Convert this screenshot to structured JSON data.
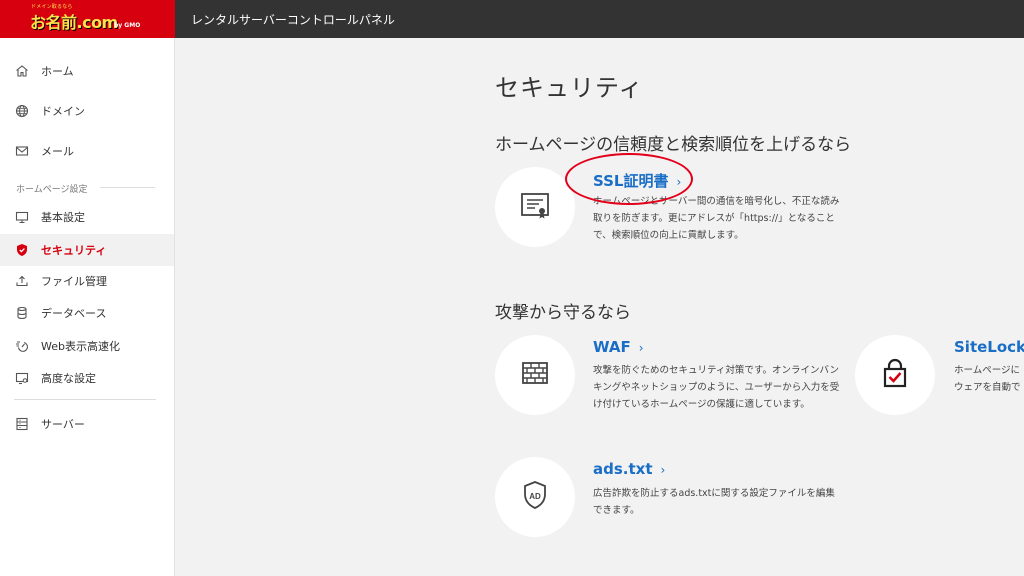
{
  "logo": {
    "tagline": "ドメイン取るなら",
    "brand": "お名前.com",
    "sub": "by GMO"
  },
  "header": {
    "title": "レンタルサーバーコントロールパネル"
  },
  "sidebar": {
    "items": [
      {
        "label": "ホーム",
        "icon": "home-icon"
      },
      {
        "label": "ドメイン",
        "icon": "globe-icon"
      },
      {
        "label": "メール",
        "icon": "mail-icon"
      }
    ],
    "section_label": "ホームページ設定",
    "settings_items": [
      {
        "label": "基本設定",
        "icon": "monitor-icon"
      },
      {
        "label": "セキュリティ",
        "icon": "shield-icon",
        "active": true
      },
      {
        "label": "ファイル管理",
        "icon": "upload-icon"
      },
      {
        "label": "データベース",
        "icon": "database-icon"
      },
      {
        "label": "Web表示高速化",
        "icon": "speed-icon"
      },
      {
        "label": "高度な設定",
        "icon": "advanced-settings-icon"
      }
    ],
    "server_item": {
      "label": "サーバー",
      "icon": "server-icon"
    }
  },
  "main": {
    "page_title": "セキュリティ",
    "section1": {
      "title": "ホームページの信頼度と検索順位を上げるなら",
      "cards": [
        {
          "title": "SSL証明書",
          "icon": "certificate-icon",
          "desc": "ホームページとサーバー間の通信を暗号化し、不正な読み取りを防ぎます。更にアドレスが「https://」となることで、検索順位の向上に貢献します。"
        }
      ]
    },
    "section2": {
      "title": "攻撃から守るなら",
      "cards": [
        {
          "title": "WAF",
          "icon": "firewall-icon",
          "desc": "攻撃を防ぐためのセキュリティ対策です。オンラインバンキングやネットショップのように、ユーザーから入力を受け付けているホームページの保護に適しています。"
        },
        {
          "title": "ads.txt",
          "icon": "ad-shield-icon",
          "desc": "広告詐欺を防止するads.txtに関する設定ファイルを編集できます。"
        },
        {
          "title": "SiteLock",
          "icon": "sitelock-icon",
          "desc": "ホームページにウェアを自動で"
        }
      ]
    }
  },
  "colors": {
    "brand_red": "#d7000f",
    "link_blue": "#1a6ec6",
    "header_bg": "#333333",
    "highlight": "#e2001a"
  }
}
